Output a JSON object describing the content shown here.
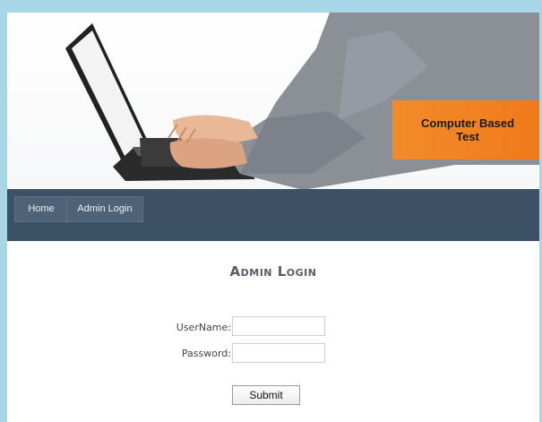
{
  "banner": {
    "brand_text": "Computer Based Test",
    "image_subject": "laptop-keyboard-hands"
  },
  "nav": {
    "items": [
      {
        "label": "Home"
      },
      {
        "label": "Admin Login"
      }
    ]
  },
  "login": {
    "title": "Admin Login",
    "username_label": "UserName:",
    "password_label": "Password:",
    "username_value": "",
    "password_value": "",
    "submit_label": "Submit"
  },
  "colors": {
    "page_background": "#a9d6e6",
    "nav_background": "#3d5166",
    "brand_box": "#f28b2a"
  }
}
